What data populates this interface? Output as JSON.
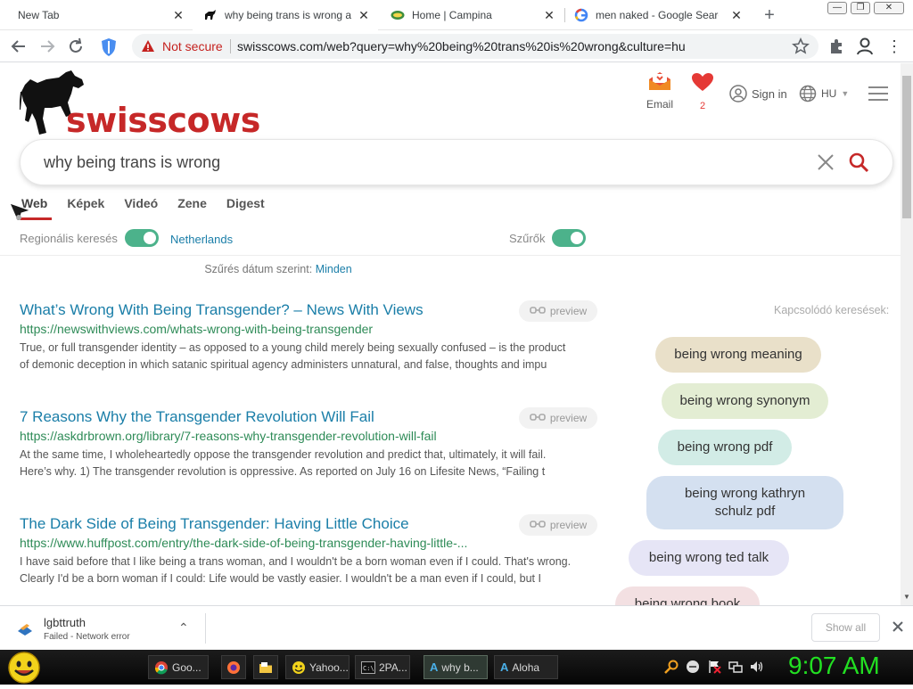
{
  "tabs": [
    {
      "title": "New Tab"
    },
    {
      "title": "why being trans is wrong a"
    },
    {
      "title": "Home | Campina"
    },
    {
      "title": "men naked - Google Search"
    }
  ],
  "address": {
    "security": "Not secure",
    "url": "swisscows.com/web?query=why%20being%20trans%20is%20wrong&culture=hu"
  },
  "header": {
    "logo_text": "swisscows",
    "email_label": "Email",
    "favorites_count": "2",
    "signin_label": "Sign in",
    "lang_label": "HU"
  },
  "search": {
    "query": "why being trans is wrong"
  },
  "nav": {
    "tabs": [
      "Web",
      "Képek",
      "Videó",
      "Zene",
      "Digest"
    ]
  },
  "filters": {
    "regional_label": "Regionális keresés",
    "region": "Netherlands",
    "filters_label": "Szűrők",
    "date_label": "Szűrés dátum szerint:",
    "date_value": "Minden"
  },
  "results": [
    {
      "title": "What’s Wrong With Being Transgender? – News With Views",
      "url": "https://newswithviews.com/whats-wrong-with-being-transgender",
      "snippet": [
        "True, or full transgender identity – as opposed to a young child merely being sexually confused – is the product",
        "of demonic deception in which satanic spiritual agency administers unnatural, and false, thoughts and impu"
      ]
    },
    {
      "title": "7 Reasons Why the Transgender Revolution Will Fail",
      "url": "https://askdrbrown.org/library/7-reasons-why-transgender-revolution-will-fail",
      "snippet": [
        "At the same time, I wholeheartedly oppose the transgender revolution and predict that, ultimately, it will fail.",
        "Here’s why. 1) The transgender revolution is oppressive. As reported on July 16 on Lifesite News, “Failing t"
      ]
    },
    {
      "title": "The Dark Side of Being Transgender: Having Little Choice",
      "url": "https://www.huffpost.com/entry/the-dark-side-of-being-transgender-having-little-...",
      "snippet": [
        "I have said before that I like being a trans woman, and I wouldn't be a born woman even if I could. That's wrong.",
        "Clearly I'd be a born woman if I could: Life would be vastly easier. I wouldn't be a man even if I could, but I"
      ]
    }
  ],
  "preview_label": "preview",
  "related": {
    "heading": "Kapcsolódó keresések:",
    "items": [
      "being wrong meaning",
      "being wrong synonym",
      "being wrong pdf",
      "being wrong kathryn schulz pdf",
      "being wrong ted talk",
      "being wrong book"
    ]
  },
  "download": {
    "file": "lgbttruth",
    "status": "Failed - Network error",
    "show_all": "Show all"
  },
  "taskbar": {
    "items": [
      "Goo...",
      "",
      "",
      "Yahoo...",
      "2PA...",
      "why b...",
      "Aloha"
    ],
    "clock": "9:07 AM"
  },
  "colors": {
    "brand_red": "#c62828",
    "link_blue": "#1a7ea8",
    "url_green": "#2e8b57",
    "toggle_green": "#4cb28b",
    "clock_green": "#22e022"
  }
}
